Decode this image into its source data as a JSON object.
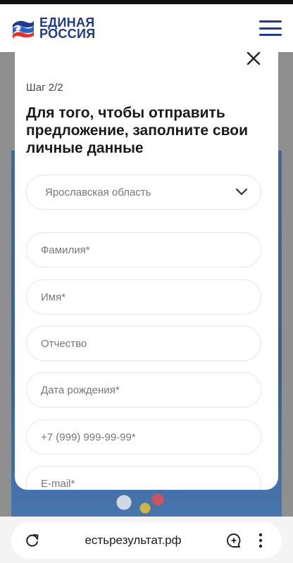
{
  "header": {
    "logo_line1": "ЕДИНАЯ",
    "logo_line2": "РОССИЯ",
    "brand_color": "#1f3b8c",
    "menu_icon": "hamburger-menu-icon"
  },
  "modal": {
    "close_icon": "close-icon",
    "step": "Шаг 2/2",
    "title": "Для того, чтобы отправить предложение, заполните свои личные данные",
    "region_select": {
      "value": "Ярославская область",
      "icon": "chevron-down-icon"
    },
    "fields": {
      "last_name": "Фамилия*",
      "first_name": "Имя*",
      "middle_name": "Отчество",
      "birth_date": "Дата рождения*",
      "phone": "+7 (999) 999-99-99*",
      "email": "E-mail*"
    }
  },
  "browser": {
    "url": "естьрезультат.рф",
    "reload_icon": "reload-icon",
    "assistant_icon": "assistant-chat-icon",
    "more_icon": "more-vertical-icon"
  }
}
